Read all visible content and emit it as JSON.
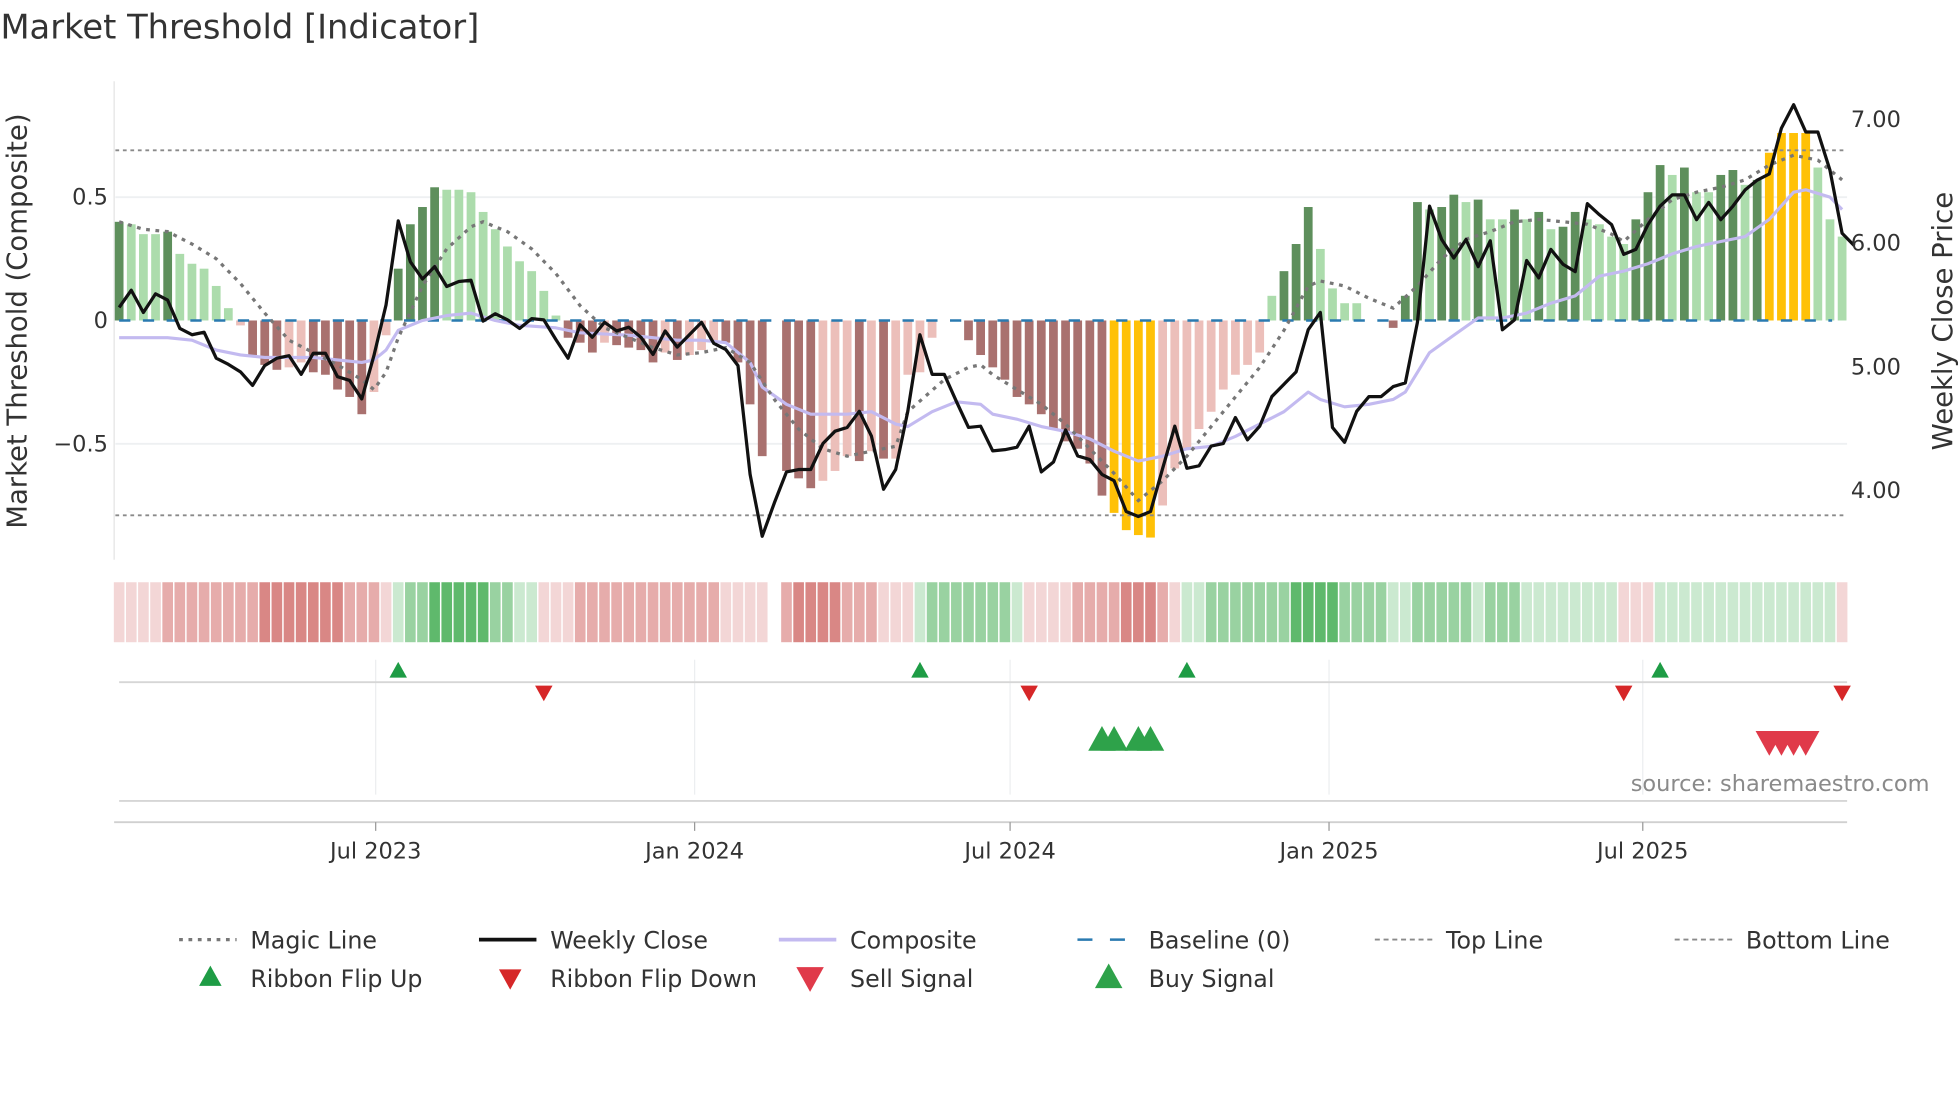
{
  "chart_data": {
    "type": "bar",
    "title": "Market Threshold [Indicator]",
    "ylabel_left": "Market Threshold (Composite)",
    "ylabel_right": "Weekly Close Price",
    "source": "source: sharemaestro.com",
    "start_date": "2023-02-03",
    "week_count": 143,
    "ylim_left": [
      -0.97,
      0.97
    ],
    "ylim_right": [
      3.43,
      7.3
    ],
    "left_ticks": [
      {
        "v": 0.5,
        "label": "0.5"
      },
      {
        "v": 0,
        "label": "0"
      },
      {
        "v": -0.5,
        "label": "−0.5"
      }
    ],
    "right_ticks": [
      {
        "v": 7,
        "label": "7.00"
      },
      {
        "v": 6,
        "label": "6.00"
      },
      {
        "v": 5,
        "label": "5.00"
      },
      {
        "v": 4,
        "label": "4.00"
      }
    ],
    "x_ticks": [
      {
        "date": "2023-07-01",
        "label": "Jul 2023"
      },
      {
        "date": "2024-01-01",
        "label": "Jan 2024"
      },
      {
        "date": "2024-07-01",
        "label": "Jul 2024"
      },
      {
        "date": "2025-01-01",
        "label": "Jan 2025"
      },
      {
        "date": "2025-07-01",
        "label": "Jul 2025"
      }
    ],
    "top_line": 0.69,
    "bottom_line": -0.79,
    "baseline": 0,
    "extreme_hi": 0.66,
    "extreme_lo": -0.77,
    "colors": {
      "dark_green": "#5e8f5c",
      "light_green": "#acdcac",
      "dark_red": "#a9716f",
      "light_red": "#ecbfba",
      "yellow": "#ffc107",
      "close": "#111111",
      "magic": "#777777",
      "composite": "#c3baf0",
      "baseline": "#2a7ab0",
      "threshold": "#8a8a8a",
      "flip_up": "#1e9c45",
      "flip_down": "#d62728",
      "buy": "#2ea24a",
      "sell": "#e03a4a"
    },
    "ribbon_colors": {
      "red": [
        "#f3d6d6",
        "#e6acab",
        "#d98785"
      ],
      "green": [
        "#cbe9d0",
        "#99d2a1",
        "#5fb96c"
      ]
    },
    "composite_bars": [
      0.4,
      0.39,
      0.35,
      0.35,
      0.36,
      0.27,
      0.23,
      0.21,
      0.14,
      0.05,
      -0.02,
      -0.14,
      -0.18,
      -0.2,
      -0.19,
      -0.17,
      -0.21,
      -0.22,
      -0.28,
      -0.31,
      -0.38,
      -0.29,
      -0.06,
      0.21,
      0.39,
      0.46,
      0.54,
      0.53,
      0.53,
      0.52,
      0.44,
      0.37,
      0.3,
      0.24,
      0.2,
      0.12,
      0.02,
      -0.07,
      -0.09,
      -0.13,
      -0.09,
      -0.1,
      -0.11,
      -0.12,
      -0.17,
      -0.13,
      -0.16,
      -0.14,
      -0.12,
      -0.08,
      -0.09,
      -0.17,
      -0.34,
      -0.55,
      0,
      -0.61,
      -0.64,
      -0.68,
      -0.65,
      -0.61,
      -0.55,
      -0.57,
      -0.53,
      -0.56,
      -0.56,
      -0.22,
      -0.21,
      -0.07,
      0,
      0,
      -0.08,
      -0.14,
      -0.19,
      -0.24,
      -0.31,
      -0.34,
      -0.38,
      -0.44,
      -0.49,
      -0.52,
      -0.58,
      -0.71,
      -0.78,
      -0.85,
      -0.87,
      -0.88,
      -0.75,
      -0.6,
      -0.52,
      -0.44,
      -0.37,
      -0.28,
      -0.22,
      -0.18,
      -0.13,
      0.1,
      0.2,
      0.31,
      0.46,
      0.29,
      0.13,
      0.07,
      0.07,
      0,
      0,
      -0.03,
      0.1,
      0.48,
      0.45,
      0.46,
      0.51,
      0.48,
      0.49,
      0.41,
      0.41,
      0.45,
      0.41,
      0.44,
      0.37,
      0.38,
      0.44,
      0.41,
      0.39,
      0.34,
      0.31,
      0.41,
      0.52,
      0.63,
      0.59,
      0.62,
      0.52,
      0.52,
      0.59,
      0.61,
      0.55,
      0.57,
      0.68,
      0.76,
      0.76,
      0.76,
      0.62,
      0.41,
      0.34
    ],
    "weekly_close": [
      5.47,
      5.61,
      5.43,
      5.58,
      5.53,
      5.3,
      5.25,
      5.27,
      5.06,
      5.01,
      4.95,
      4.84,
      5.0,
      5.06,
      5.08,
      4.93,
      5.1,
      5.1,
      4.91,
      4.88,
      4.73,
      5.08,
      5.49,
      6.17,
      5.84,
      5.7,
      5.8,
      5.64,
      5.68,
      5.69,
      5.36,
      5.42,
      5.37,
      5.3,
      5.38,
      5.37,
      5.21,
      5.06,
      5.33,
      5.23,
      5.35,
      5.28,
      5.31,
      5.23,
      5.09,
      5.28,
      5.15,
      5.25,
      5.35,
      5.18,
      5.13,
      5.0,
      4.12,
      3.62,
      3.89,
      4.14,
      4.16,
      4.16,
      4.37,
      4.47,
      4.5,
      4.63,
      4.43,
      4.0,
      4.16,
      4.63,
      5.25,
      4.93,
      4.93,
      4.71,
      4.5,
      4.51,
      4.31,
      4.32,
      4.34,
      4.51,
      4.14,
      4.22,
      4.48,
      4.27,
      4.24,
      4.12,
      4.07,
      3.82,
      3.78,
      3.82,
      4.17,
      4.51,
      4.17,
      4.19,
      4.35,
      4.37,
      4.58,
      4.4,
      4.51,
      4.75,
      4.85,
      4.95,
      5.29,
      5.43,
      4.5,
      4.38,
      4.63,
      4.75,
      4.75,
      4.83,
      4.86,
      5.35,
      6.29,
      6.02,
      5.87,
      6.02,
      5.8,
      6.01,
      5.29,
      5.37,
      5.85,
      5.71,
      5.94,
      5.82,
      5.76,
      6.31,
      6.22,
      6.14,
      5.9,
      5.94,
      6.14,
      6.29,
      6.38,
      6.38,
      6.18,
      6.32,
      6.18,
      6.29,
      6.42,
      6.5,
      6.55,
      6.92,
      7.11,
      6.89,
      6.89,
      6.58,
      6.07,
      5.97
    ],
    "magic_line": [
      [
        0,
        0.4
      ],
      [
        2,
        0.37
      ],
      [
        4,
        0.36
      ],
      [
        6,
        0.31
      ],
      [
        8,
        0.25
      ],
      [
        10,
        0.15
      ],
      [
        12,
        0.03
      ],
      [
        14,
        -0.08
      ],
      [
        16,
        -0.13
      ],
      [
        18,
        -0.18
      ],
      [
        20,
        -0.24
      ],
      [
        21,
        -0.28
      ],
      [
        22,
        -0.21
      ],
      [
        23,
        -0.07
      ],
      [
        25,
        0.14
      ],
      [
        27,
        0.29
      ],
      [
        29,
        0.38
      ],
      [
        30,
        0.4
      ],
      [
        32,
        0.36
      ],
      [
        34,
        0.29
      ],
      [
        36,
        0.19
      ],
      [
        38,
        0.06
      ],
      [
        40,
        -0.03
      ],
      [
        42,
        -0.07
      ],
      [
        44,
        -0.11
      ],
      [
        46,
        -0.14
      ],
      [
        48,
        -0.13
      ],
      [
        50,
        -0.11
      ],
      [
        52,
        -0.17
      ],
      [
        54,
        -0.32
      ],
      [
        56,
        -0.44
      ],
      [
        58,
        -0.52
      ],
      [
        60,
        -0.55
      ],
      [
        62,
        -0.53
      ],
      [
        64,
        -0.51
      ],
      [
        65,
        -0.37
      ],
      [
        68,
        -0.24
      ],
      [
        70,
        -0.19
      ],
      [
        71,
        -0.18
      ],
      [
        72,
        -0.22
      ],
      [
        74,
        -0.28
      ],
      [
        76,
        -0.34
      ],
      [
        78,
        -0.42
      ],
      [
        80,
        -0.52
      ],
      [
        82,
        -0.62
      ],
      [
        84,
        -0.73
      ],
      [
        86,
        -0.65
      ],
      [
        88,
        -0.55
      ],
      [
        90,
        -0.43
      ],
      [
        92,
        -0.31
      ],
      [
        94,
        -0.19
      ],
      [
        96,
        -0.04
      ],
      [
        98,
        0.14
      ],
      [
        99,
        0.16
      ],
      [
        101,
        0.14
      ],
      [
        103,
        0.09
      ],
      [
        105,
        0.05
      ],
      [
        107,
        0.14
      ],
      [
        109,
        0.25
      ],
      [
        111,
        0.33
      ],
      [
        113,
        0.36
      ],
      [
        115,
        0.4
      ],
      [
        117,
        0.41
      ],
      [
        119,
        0.4
      ],
      [
        121,
        0.39
      ],
      [
        123,
        0.35
      ],
      [
        124,
        0.32
      ],
      [
        126,
        0.41
      ],
      [
        128,
        0.49
      ],
      [
        130,
        0.52
      ],
      [
        132,
        0.54
      ],
      [
        134,
        0.57
      ],
      [
        136,
        0.63
      ],
      [
        138,
        0.67
      ],
      [
        140,
        0.65
      ],
      [
        142,
        0.57
      ]
    ],
    "composite_line": [
      [
        0,
        -0.07
      ],
      [
        4,
        -0.07
      ],
      [
        6,
        -0.08
      ],
      [
        8,
        -0.12
      ],
      [
        10,
        -0.14
      ],
      [
        12,
        -0.15
      ],
      [
        16,
        -0.15
      ],
      [
        18,
        -0.16
      ],
      [
        20,
        -0.17
      ],
      [
        21,
        -0.16
      ],
      [
        22,
        -0.12
      ],
      [
        23,
        -0.04
      ],
      [
        25,
        0
      ],
      [
        27,
        0.02
      ],
      [
        29,
        0.03
      ],
      [
        31,
        0
      ],
      [
        33,
        -0.02
      ],
      [
        36,
        -0.03
      ],
      [
        38,
        -0.05
      ],
      [
        42,
        -0.06
      ],
      [
        46,
        -0.08
      ],
      [
        48,
        -0.08
      ],
      [
        50,
        -0.09
      ],
      [
        52,
        -0.17
      ],
      [
        53,
        -0.27
      ],
      [
        55,
        -0.34
      ],
      [
        57,
        -0.38
      ],
      [
        60,
        -0.38
      ],
      [
        62,
        -0.37
      ],
      [
        64,
        -0.42
      ],
      [
        65,
        -0.43
      ],
      [
        67,
        -0.37
      ],
      [
        69,
        -0.33
      ],
      [
        71,
        -0.34
      ],
      [
        72,
        -0.38
      ],
      [
        74,
        -0.4
      ],
      [
        76,
        -0.43
      ],
      [
        78,
        -0.45
      ],
      [
        80,
        -0.48
      ],
      [
        82,
        -0.53
      ],
      [
        84,
        -0.57
      ],
      [
        86,
        -0.55
      ],
      [
        88,
        -0.52
      ],
      [
        90,
        -0.51
      ],
      [
        92,
        -0.47
      ],
      [
        94,
        -0.42
      ],
      [
        96,
        -0.37
      ],
      [
        98,
        -0.29
      ],
      [
        99,
        -0.32
      ],
      [
        101,
        -0.35
      ],
      [
        103,
        -0.34
      ],
      [
        105,
        -0.32
      ],
      [
        106,
        -0.29
      ],
      [
        108,
        -0.13
      ],
      [
        110,
        -0.06
      ],
      [
        112,
        0.01
      ],
      [
        114,
        0.01
      ],
      [
        116,
        0.03
      ],
      [
        118,
        0.07
      ],
      [
        120,
        0.1
      ],
      [
        122,
        0.18
      ],
      [
        124,
        0.2
      ],
      [
        126,
        0.23
      ],
      [
        128,
        0.27
      ],
      [
        130,
        0.3
      ],
      [
        132,
        0.32
      ],
      [
        134,
        0.34
      ],
      [
        136,
        0.41
      ],
      [
        138,
        0.52
      ],
      [
        139,
        0.53
      ],
      [
        141,
        0.5
      ],
      [
        142,
        0.45
      ]
    ],
    "ribbon": [
      -1,
      -1,
      -1,
      -1,
      -2,
      -2,
      -2,
      -2,
      -2,
      -2,
      -2,
      -2,
      -3,
      -3,
      -3,
      -3,
      -3,
      -3,
      -3,
      -2,
      -2,
      -2,
      -1,
      1,
      2,
      2,
      3,
      3,
      3,
      3,
      3,
      2,
      2,
      1,
      1,
      -1,
      -1,
      -1,
      -2,
      -2,
      -2,
      -2,
      -2,
      -2,
      -2,
      -2,
      -2,
      -2,
      -2,
      -2,
      -1,
      -1,
      -1,
      -1,
      0,
      -2,
      -3,
      -3,
      -3,
      -3,
      -2,
      -2,
      -2,
      -1,
      -1,
      -1,
      1,
      2,
      2,
      2,
      2,
      2,
      2,
      2,
      1,
      -1,
      -1,
      -1,
      -1,
      -2,
      -2,
      -2,
      -2,
      -3,
      -3,
      -3,
      -2,
      -1,
      1,
      1,
      2,
      2,
      2,
      2,
      2,
      2,
      2,
      3,
      3,
      3,
      3,
      2,
      2,
      2,
      2,
      1,
      1,
      2,
      2,
      2,
      2,
      2,
      1,
      2,
      2,
      2,
      1,
      1,
      1,
      1,
      1,
      1,
      1,
      1,
      -1,
      -1,
      -1,
      1,
      1,
      1,
      1,
      1,
      1,
      1,
      1,
      1,
      1,
      1,
      1,
      1,
      1,
      1,
      -1
    ],
    "ribbon_flip_up": [
      23,
      66,
      88,
      127
    ],
    "ribbon_flip_down": [
      35,
      75,
      124,
      142
    ],
    "buy_signals": [
      81,
      82,
      84,
      85
    ],
    "sell_signals": [
      136,
      137,
      138,
      139
    ],
    "legend": [
      {
        "label": "Magic Line",
        "kind": "dotted",
        "color": "#777777"
      },
      {
        "label": "Weekly Close",
        "kind": "solid",
        "color": "#111111"
      },
      {
        "label": "Composite",
        "kind": "solid-light",
        "color": "#c3baf0"
      },
      {
        "label": "Baseline (0)",
        "kind": "dashed",
        "color": "#2a7ab0"
      },
      {
        "label": "Top Line",
        "kind": "thin-dotted",
        "color": "#8a8a8a"
      },
      {
        "label": "Bottom Line",
        "kind": "thin-dotted",
        "color": "#8a8a8a"
      },
      {
        "label": "Ribbon Flip Up",
        "kind": "tri-up",
        "color": "#1e9c45"
      },
      {
        "label": "Ribbon Flip Down",
        "kind": "tri-down",
        "color": "#d62728"
      },
      {
        "label": "Sell Signal",
        "kind": "tri-down-big",
        "color": "#e03a4a"
      },
      {
        "label": "Buy Signal",
        "kind": "tri-up-big",
        "color": "#2ea24a"
      }
    ]
  }
}
